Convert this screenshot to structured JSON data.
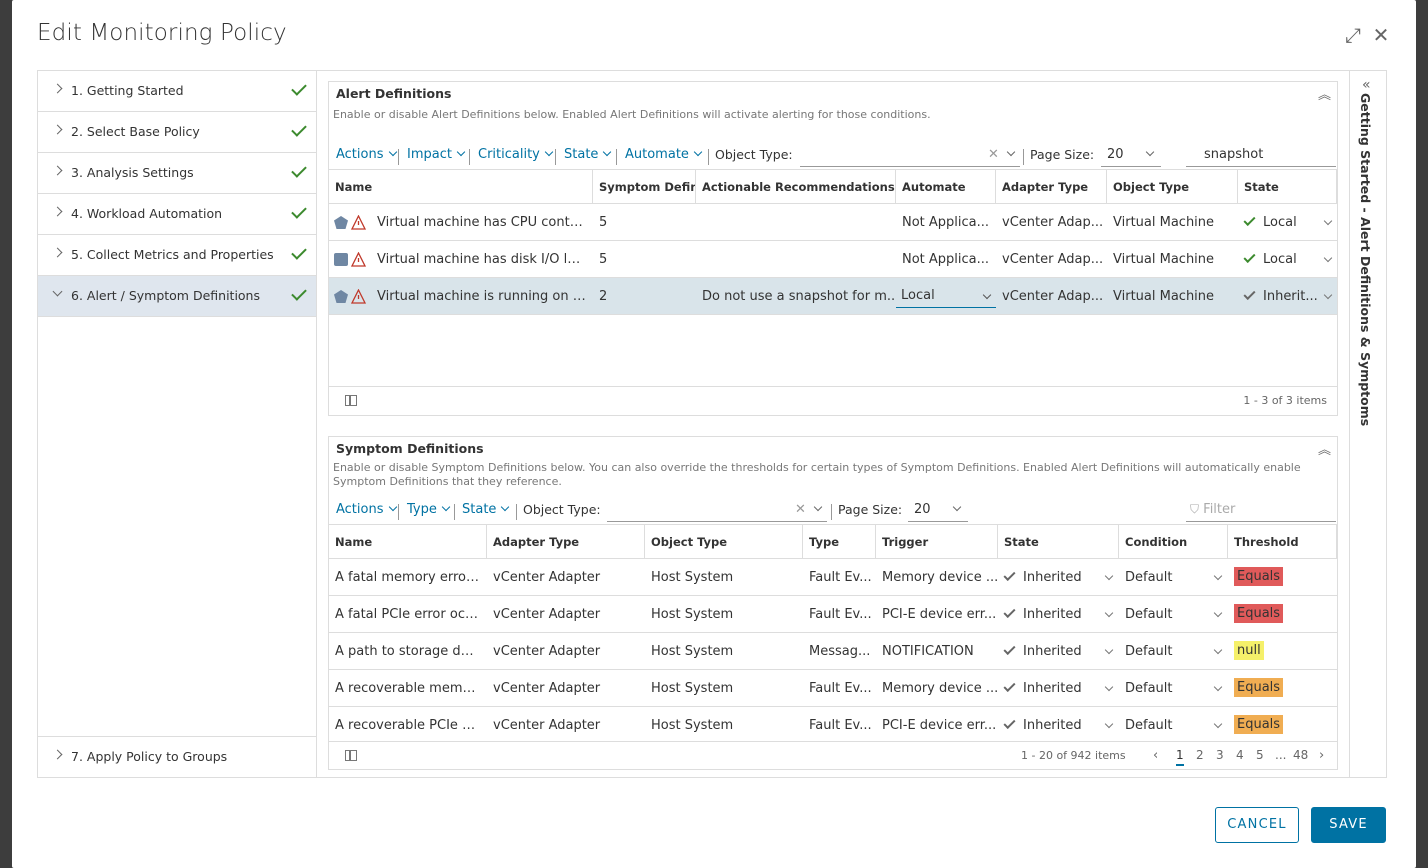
{
  "modal": {
    "title": "Edit Monitoring Policy",
    "expand_icon": "expand-icon",
    "close_icon": "close-icon"
  },
  "steps": [
    {
      "label": "1. Getting Started",
      "done": true
    },
    {
      "label": "2. Select Base Policy",
      "done": true
    },
    {
      "label": "3. Analysis Settings",
      "done": true
    },
    {
      "label": "4. Workload Automation",
      "done": true
    },
    {
      "label": "5. Collect Metrics and Properties",
      "done": true
    },
    {
      "label": "6. Alert / Symptom Definitions",
      "done": true,
      "active": true
    },
    {
      "label": "7. Apply Policy to Groups",
      "done": false
    }
  ],
  "rightbar": {
    "label": "Getting Started - Alert Definitions & Symptoms"
  },
  "alerts": {
    "title": "Alert Definitions",
    "description": "Enable or disable Alert Definitions below. Enabled Alert Definitions will activate alerting for those conditions.",
    "toolbar": {
      "actions": "Actions",
      "impact": "Impact",
      "criticality": "Criticality",
      "state": "State",
      "automate": "Automate",
      "object_type_label": "Object Type:",
      "object_type_value": "",
      "page_size_label": "Page Size:",
      "page_size_value": "20",
      "search_value": "snapshot"
    },
    "columns": [
      "Name",
      "Symptom Defini...",
      "Actionable Recommendations",
      "Automate",
      "Adapter Type",
      "Object Type",
      "State"
    ],
    "rows": [
      {
        "name": "Virtual machine has CPU conten...",
        "symptoms": "5",
        "recommendation": "",
        "automate": "Not Applica...",
        "adapter": "vCenter Adap...",
        "object_type": "Virtual Machine",
        "state": "Local",
        "state_kind": "local"
      },
      {
        "name": "Virtual machine has disk I/O late...",
        "symptoms": "5",
        "recommendation": "",
        "automate": "Not Applica...",
        "adapter": "vCenter Adap...",
        "object_type": "Virtual Machine",
        "state": "Local",
        "state_kind": "local"
      },
      {
        "name": "Virtual machine is running on sn...",
        "symptoms": "2",
        "recommendation": "Do not use a snapshot for m...",
        "automate": "Local",
        "adapter": "vCenter Adap...",
        "object_type": "Virtual Machine",
        "state": "Inherit...",
        "state_kind": "inherited",
        "selected": true
      }
    ],
    "footer": "1 - 3 of 3 items"
  },
  "symptoms": {
    "title": "Symptom Definitions",
    "description": "Enable or disable Symptom Definitions below. You can also override the thresholds for certain types of Symptom Definitions. Enabled Alert Definitions will automatically enable Symptom Definitions that they reference.",
    "toolbar": {
      "actions": "Actions",
      "type": "Type",
      "state": "State",
      "object_type_label": "Object Type:",
      "object_type_value": "",
      "page_size_label": "Page Size:",
      "page_size_value": "20",
      "filter_placeholder": "Filter"
    },
    "columns": [
      "Name",
      "Adapter Type",
      "Object Type",
      "Type",
      "Trigger",
      "State",
      "Condition",
      "Threshold"
    ],
    "rows": [
      {
        "name": "A fatal memory error ...",
        "adapter": "vCenter Adapter",
        "object_type": "Host System",
        "type": "Fault Ev...",
        "trigger": "Memory device ...",
        "state": "Inherited",
        "condition": "Default",
        "threshold": "Equals",
        "threshold_color": "#e05a5a"
      },
      {
        "name": "A fatal PCIe error occ...",
        "adapter": "vCenter Adapter",
        "object_type": "Host System",
        "type": "Fault Ev...",
        "trigger": "PCI-E device err...",
        "state": "Inherited",
        "condition": "Default",
        "threshold": "Equals",
        "threshold_color": "#e05a5a"
      },
      {
        "name": "A path to storage dev...",
        "adapter": "vCenter Adapter",
        "object_type": "Host System",
        "type": "Messag...",
        "trigger": "NOTIFICATION",
        "state": "Inherited",
        "condition": "Default",
        "threshold": "null",
        "threshold_color": "#f5f06a"
      },
      {
        "name": "A recoverable memor...",
        "adapter": "vCenter Adapter",
        "object_type": "Host System",
        "type": "Fault Ev...",
        "trigger": "Memory device ...",
        "state": "Inherited",
        "condition": "Default",
        "threshold": "Equals",
        "threshold_color": "#f0ad52"
      },
      {
        "name": "A recoverable PCIe er...",
        "adapter": "vCenter Adapter",
        "object_type": "Host System",
        "type": "Fault Ev...",
        "trigger": "PCI-E device err...",
        "state": "Inherited",
        "condition": "Default",
        "threshold": "Equals",
        "threshold_color": "#f0ad52"
      }
    ],
    "footer": "1 - 20 of 942 items",
    "pages": [
      "1",
      "2",
      "3",
      "4",
      "5",
      "...",
      "48"
    ],
    "current_page": "1"
  },
  "buttons": {
    "cancel": "CANCEL",
    "save": "SAVE"
  },
  "colors": {
    "accent": "#0072a3",
    "success": "#3c8a2e",
    "selected_row": "#d9e4ea"
  }
}
